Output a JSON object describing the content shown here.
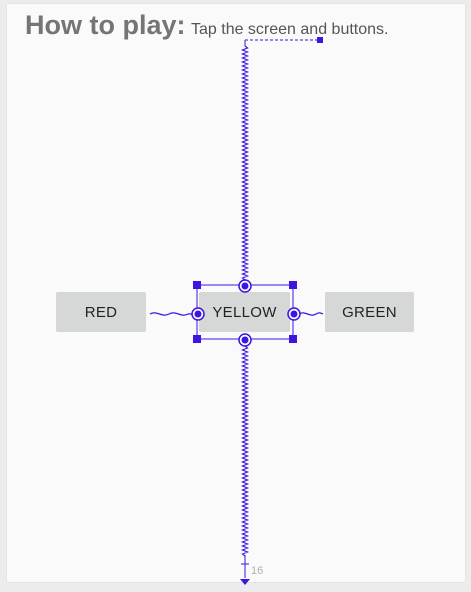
{
  "header": {
    "title": "How to play:",
    "subtitle": "Tap the screen and buttons."
  },
  "buttons": {
    "red": "RED",
    "yellow": "YELLOW",
    "green": "GREEN"
  },
  "constraint": {
    "bottom_margin": "16"
  },
  "colors": {
    "constraint": "#3d14e0",
    "button_bg": "#d6d7d7",
    "title": "#757575"
  }
}
